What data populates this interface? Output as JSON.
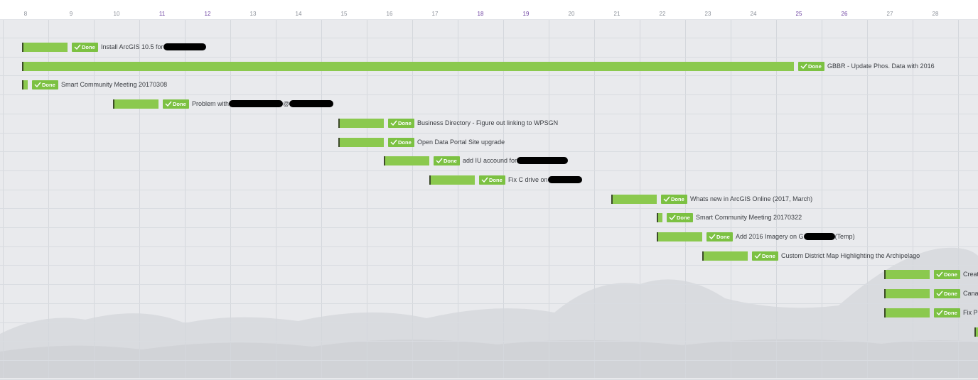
{
  "timeline": {
    "days": [
      {
        "label": "8",
        "weekend": false
      },
      {
        "label": "9",
        "weekend": false
      },
      {
        "label": "10",
        "weekend": false
      },
      {
        "label": "11",
        "weekend": true
      },
      {
        "label": "12",
        "weekend": true
      },
      {
        "label": "13",
        "weekend": false
      },
      {
        "label": "14",
        "weekend": false
      },
      {
        "label": "15",
        "weekend": false
      },
      {
        "label": "16",
        "weekend": false
      },
      {
        "label": "17",
        "weekend": false
      },
      {
        "label": "18",
        "weekend": true
      },
      {
        "label": "19",
        "weekend": true
      },
      {
        "label": "20",
        "weekend": false
      },
      {
        "label": "21",
        "weekend": false
      },
      {
        "label": "22",
        "weekend": false
      },
      {
        "label": "23",
        "weekend": false
      },
      {
        "label": "24",
        "weekend": false
      },
      {
        "label": "25",
        "weekend": true
      },
      {
        "label": "26",
        "weekend": true
      },
      {
        "label": "27",
        "weekend": false
      },
      {
        "label": "28",
        "weekend": false
      }
    ]
  },
  "status_label": "Done",
  "colors": {
    "bar": "#8bc94e",
    "badge": "#7cc142",
    "weekend_label": "#6b3fa0"
  },
  "tasks": [
    {
      "title": "Install ArcGIS 10.5 for",
      "redacted": true,
      "status": "Done"
    },
    {
      "title": "GBBR - Update Phos. Data with 2016",
      "redacted": false,
      "status": "Done"
    },
    {
      "title": "Smart Community Meeting 20170308",
      "redacted": false,
      "status": "Done"
    },
    {
      "title": "Problem with",
      "title_mid": "@",
      "redacted": true,
      "status": "Done"
    },
    {
      "title": "Business Directory - Figure out linking to WPSGN",
      "redacted": false,
      "status": "Done"
    },
    {
      "title": "Open Data Portal Site upgrade",
      "redacted": false,
      "status": "Done"
    },
    {
      "title": "add IU accound for",
      "redacted": true,
      "status": "Done"
    },
    {
      "title": "Fix C drive on",
      "redacted": true,
      "status": "Done"
    },
    {
      "title": "Whats new in ArcGIS Online (2017, March)",
      "redacted": false,
      "status": "Done"
    },
    {
      "title": "Smart Community Meeting 20170322",
      "redacted": false,
      "status": "Done"
    },
    {
      "title": "Add 2016 Imagery on G",
      "title_suffix": "(Temp)",
      "redacted": true,
      "status": "Done"
    },
    {
      "title": "Custom District Map Highlighting the Archipelago",
      "redacted": false,
      "status": "Done"
    },
    {
      "title": "Creat",
      "redacted": false,
      "status": "Done"
    },
    {
      "title": "Cana",
      "redacted": false,
      "status": "Done"
    },
    {
      "title": "Fix Pr",
      "redacted": false,
      "status": "Done"
    }
  ]
}
